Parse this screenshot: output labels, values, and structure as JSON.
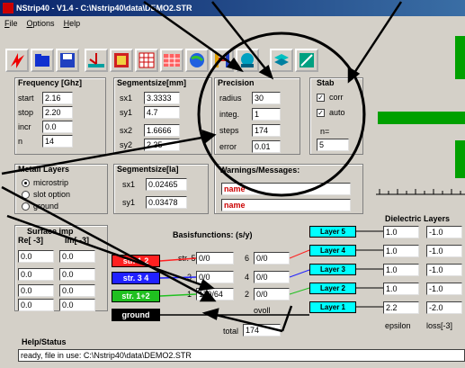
{
  "window": {
    "title": "NStrip40 - V1.4 - C:\\Nstrip40\\data\\DEMO2.STR"
  },
  "menu": [
    "File",
    "Options",
    "Help"
  ],
  "toolbar_icons": [
    "lightning-icon",
    "folder-icon",
    "save-icon",
    "antenna-icon",
    "plot-icon",
    "grid-icon",
    "globe-icon",
    "bridge-icon",
    "person-icon",
    "layers-icon",
    "brush-icon"
  ],
  "frequency": {
    "title": "Frequency [Ghz]",
    "start_label": "start",
    "start": "2.16",
    "stop_label": "stop",
    "stop": "2.20",
    "incr_label": "incr",
    "incr": "0.0",
    "n_label": "n",
    "n": "14"
  },
  "segsize_mm": {
    "title": "Segmentsize[mm]",
    "sx1_label": "sx1",
    "sx1": "3.3333",
    "sy1_label": "sy1",
    "sy1": "4.7",
    "sx2_label": "sx2",
    "sx2": "1.6666",
    "sy2_label": "sy2",
    "sy2": "2.35"
  },
  "precision": {
    "title": "Precision",
    "radius_label": "radius",
    "radius": "30",
    "integ_label": "integ.",
    "integ": "1",
    "steps_label": "steps",
    "steps": "174",
    "error_label": "error",
    "error": "0.01"
  },
  "stab": {
    "title": "Stab",
    "corr_label": "corr",
    "auto_label": "auto",
    "n_label": "n=",
    "n": "5"
  },
  "metal_layers": {
    "title": "Metall Layers",
    "options": [
      "microstrip",
      "slot option",
      "ground"
    ]
  },
  "segsize_la": {
    "title": "Segmentsize[la]",
    "sx1_label": "sx1",
    "sx1": "0.02465",
    "sy1_label": "sy1",
    "sy1": "0.03478"
  },
  "warnings": {
    "title": "Warnings/Messages:",
    "msg1": "name",
    "msg2": "name"
  },
  "surface": {
    "title": "Surface imp",
    "re_label": "Re[ -3]",
    "im_label": "Im[ -3]",
    "rows": [
      [
        "0.0",
        "0.0"
      ],
      [
        "0.0",
        "0.0"
      ],
      [
        "0.0",
        "0.0"
      ],
      [
        "0.0",
        "0.0"
      ]
    ]
  },
  "basis": {
    "title": "Basisfunctions: (s/y)",
    "col_a": [
      {
        "label": "str. 5",
        "value": "0/0"
      },
      {
        "label": "3",
        "value": "0/0"
      },
      {
        "label": "1",
        "value": "110/64"
      }
    ],
    "col_b": [
      {
        "label": "6",
        "value": "0/0"
      },
      {
        "label": "4",
        "value": "0/0"
      },
      {
        "label": "2",
        "value": "0/0"
      }
    ],
    "total_label": "total",
    "total": "174",
    "over_label": "ovoll"
  },
  "strips": [
    "str. 1 2",
    "str. 3 4",
    "str. 1+2",
    "ground"
  ],
  "strip_colors": [
    "#ff2020",
    "#2020ff",
    "#20c020",
    "#000000"
  ],
  "layers": [
    "Layer 5",
    "Layer 4",
    "Layer 3",
    "Layer 2",
    "Layer 1"
  ],
  "dielectric": {
    "title": "Dielectric Layers",
    "eps_label": "epsilon",
    "loss_label": "loss[-3]",
    "rows": [
      [
        "1.0",
        "-1.0"
      ],
      [
        "1.0",
        "-1.0"
      ],
      [
        "1.0",
        "-1.0"
      ],
      [
        "1.0",
        "-1.0"
      ],
      [
        "2.2",
        "-2.0"
      ]
    ]
  },
  "status": {
    "title": "Help/Status",
    "text": "ready, file in use: C:\\Nstrip40\\data\\DEMO2.STR"
  },
  "colors": {
    "titlebar": "#0a246a",
    "green": "#00a000",
    "cyan": "#00ffff"
  }
}
